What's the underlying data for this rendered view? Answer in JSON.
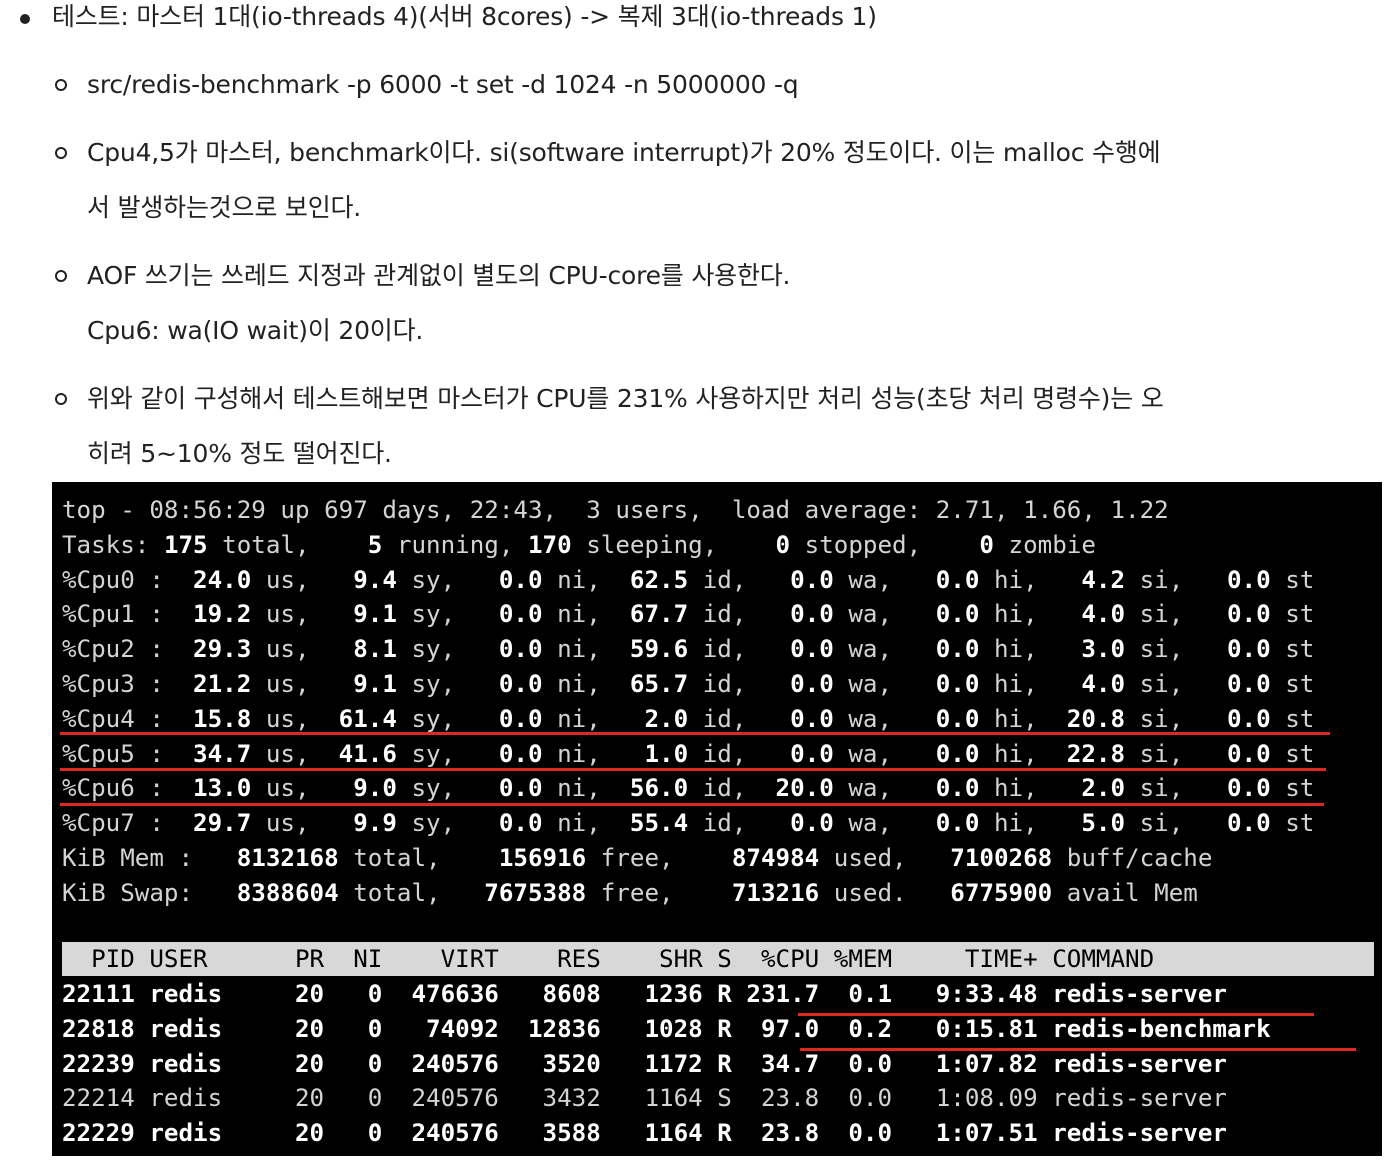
{
  "bullets": {
    "main": "테스트: 마스터 1대(io-threads 4)(서버 8cores) -> 복제 3대(io-threads 1)",
    "sub1": "src/redis-benchmark -p 6000 -t set -d 1024 -n 5000000 -q",
    "sub2_line1": "Cpu4,5가 마스터, benchmark이다. si(software interrupt)가 20% 정도이다. 이는 malloc 수행에",
    "sub2_line2": "서 발생하는것으로 보인다.",
    "sub3_line1": "AOF 쓰기는 쓰레드 지정과 관계없이 별도의 CPU-core를 사용한다.",
    "sub3_line2": "Cpu6: wa(IO wait)이 20이다.",
    "sub4_line1": "위와 같이 구성해서 테스트해보면 마스터가 CPU를 231% 사용하지만 처리 성능(초당 처리 명령수)는 오",
    "sub4_line2": "히려 5~10% 정도 떨어진다."
  },
  "terminal": {
    "top_line": "top - 08:56:29 up 697 days, 22:43,  3 users,  load average: 2.71, 1.66, 1.22",
    "tasks": {
      "total": "175",
      "running": "5",
      "sleeping": "170",
      "stopped": "0",
      "zombie": "0"
    },
    "cpus": [
      {
        "name": "%Cpu0",
        "us": "24.0",
        "sy": "9.4",
        "ni": "0.0",
        "id": "62.5",
        "wa": "0.0",
        "hi": "0.0",
        "si": "4.2",
        "st": "0.0"
      },
      {
        "name": "%Cpu1",
        "us": "19.2",
        "sy": "9.1",
        "ni": "0.0",
        "id": "67.7",
        "wa": "0.0",
        "hi": "0.0",
        "si": "4.0",
        "st": "0.0"
      },
      {
        "name": "%Cpu2",
        "us": "29.3",
        "sy": "8.1",
        "ni": "0.0",
        "id": "59.6",
        "wa": "0.0",
        "hi": "0.0",
        "si": "3.0",
        "st": "0.0"
      },
      {
        "name": "%Cpu3",
        "us": "21.2",
        "sy": "9.1",
        "ni": "0.0",
        "id": "65.7",
        "wa": "0.0",
        "hi": "0.0",
        "si": "4.0",
        "st": "0.0"
      },
      {
        "name": "%Cpu4",
        "us": "15.8",
        "sy": "61.4",
        "ni": "0.0",
        "id": "2.0",
        "wa": "0.0",
        "hi": "0.0",
        "si": "20.8",
        "st": "0.0"
      },
      {
        "name": "%Cpu5",
        "us": "34.7",
        "sy": "41.6",
        "ni": "0.0",
        "id": "1.0",
        "wa": "0.0",
        "hi": "0.0",
        "si": "22.8",
        "st": "0.0"
      },
      {
        "name": "%Cpu6",
        "us": "13.0",
        "sy": "9.0",
        "ni": "0.0",
        "id": "56.0",
        "wa": "20.0",
        "hi": "0.0",
        "si": "2.0",
        "st": "0.0"
      },
      {
        "name": "%Cpu7",
        "us": "29.7",
        "sy": "9.9",
        "ni": "0.0",
        "id": "55.4",
        "wa": "0.0",
        "hi": "0.0",
        "si": "5.0",
        "st": "0.0"
      }
    ],
    "mem": {
      "label": "KiB Mem :",
      "total": "8132168",
      "free": "156916",
      "used": "874984",
      "buff_cache": "7100268"
    },
    "swap": {
      "label": "KiB Swap:",
      "total": "8388604",
      "free": "7675388",
      "used": "713216",
      "avail_mem": "6775900"
    },
    "columns": [
      "PID",
      "USER",
      "PR",
      "NI",
      "VIRT",
      "RES",
      "SHR",
      "S",
      "%CPU",
      "%MEM",
      "TIME+",
      "COMMAND"
    ],
    "processes": [
      {
        "pid": "22111",
        "user": "redis",
        "pr": "20",
        "ni": "0",
        "virt": "476636",
        "res": "8608",
        "shr": "1236",
        "s": "R",
        "cpu": "231.7",
        "mem": "0.1",
        "time": "9:33.48",
        "command": "redis-server",
        "bold": true
      },
      {
        "pid": "22818",
        "user": "redis",
        "pr": "20",
        "ni": "0",
        "virt": "74092",
        "res": "12836",
        "shr": "1028",
        "s": "R",
        "cpu": "97.0",
        "mem": "0.2",
        "time": "0:15.81",
        "command": "redis-benchmark",
        "bold": true
      },
      {
        "pid": "22239",
        "user": "redis",
        "pr": "20",
        "ni": "0",
        "virt": "240576",
        "res": "3520",
        "shr": "1172",
        "s": "R",
        "cpu": "34.7",
        "mem": "0.0",
        "time": "1:07.82",
        "command": "redis-server",
        "bold": true
      },
      {
        "pid": "22214",
        "user": "redis",
        "pr": "20",
        "ni": "0",
        "virt": "240576",
        "res": "3432",
        "shr": "1164",
        "s": "S",
        "cpu": "23.8",
        "mem": "0.0",
        "time": "1:08.09",
        "command": "redis-server",
        "bold": false
      },
      {
        "pid": "22229",
        "user": "redis",
        "pr": "20",
        "ni": "0",
        "virt": "240576",
        "res": "3588",
        "shr": "1164",
        "s": "R",
        "cpu": "23.8",
        "mem": "0.0",
        "time": "1:07.51",
        "command": "redis-server",
        "bold": true
      }
    ]
  },
  "colors": {
    "highlight_red": "#e0281e",
    "terminal_bg": "#000000",
    "header_bg": "#d8d8d8"
  }
}
